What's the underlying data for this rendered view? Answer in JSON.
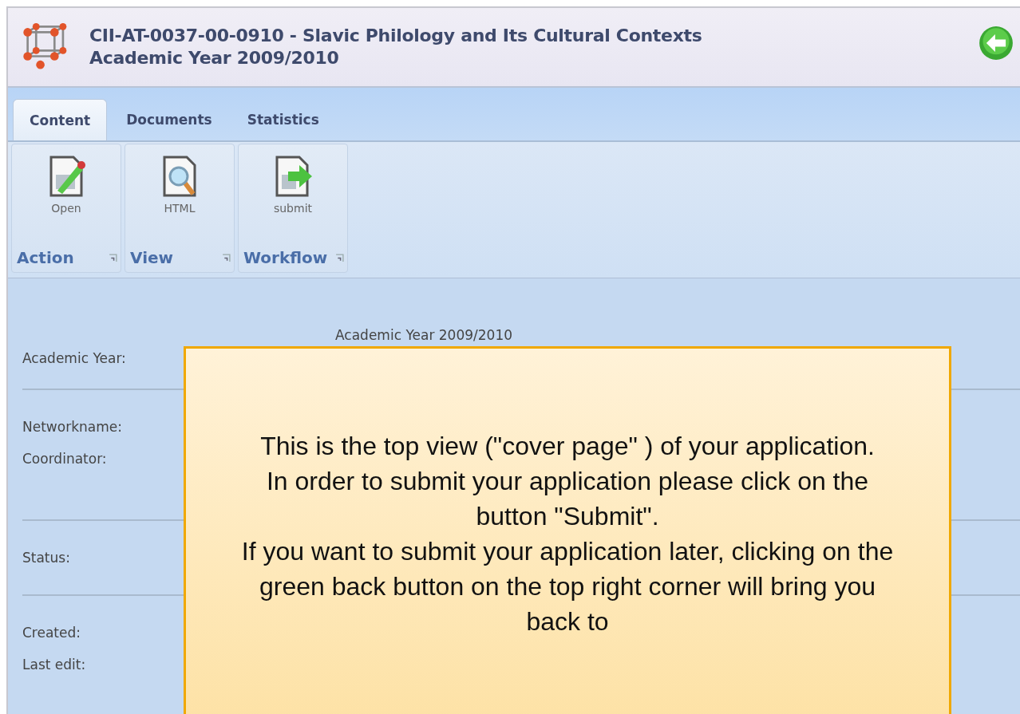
{
  "header": {
    "title": "CII-AT-0037-00-0910 - Slavic Philology and Its Cultural Contexts",
    "subtitle": "Academic Year 2009/2010"
  },
  "tabs": [
    {
      "label": "Content",
      "selected": true
    },
    {
      "label": "Documents",
      "selected": false
    },
    {
      "label": "Statistics",
      "selected": false
    }
  ],
  "toolbar_groups": [
    {
      "label": "Action",
      "button": {
        "label": "Open",
        "kind": "edit"
      }
    },
    {
      "label": "View",
      "button": {
        "label": "HTML",
        "kind": "search"
      }
    },
    {
      "label": "Workflow",
      "button": {
        "label": "submit",
        "kind": "forward"
      }
    }
  ],
  "form_sections": [
    {
      "fields": [
        {
          "label": "Academic Year:",
          "value": "Academic Year 2009/2010"
        }
      ]
    },
    {
      "fields": [
        {
          "label": "Networkname:"
        },
        {
          "label": "Coordinator:"
        }
      ]
    },
    {
      "fields": [
        {
          "label": "Status:"
        }
      ]
    },
    {
      "fields": [
        {
          "label": "Created:"
        },
        {
          "label": "Last edit:"
        }
      ]
    }
  ],
  "callout": {
    "paragraphs": [
      "This is the top view (\"cover page\" ) of your application.",
      "In order to submit your application please click on the button \"Submit\".",
      "If you want to submit your application later, clicking on the  green back button on the top right corner will bring you back to"
    ]
  }
}
